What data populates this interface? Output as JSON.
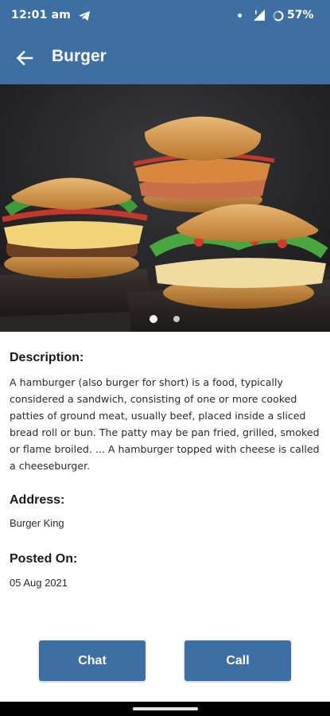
{
  "status_bar": {
    "time": "12:01 am",
    "battery_percent": "57%",
    "icons": [
      "telegram-icon",
      "notification-dot-icon",
      "signal-icon",
      "battery-ring-icon"
    ]
  },
  "app_bar": {
    "title": "Burger",
    "back_icon": "arrow-left-icon"
  },
  "carousel": {
    "image_description": "burger photo",
    "page_count": 2,
    "active_page": 1
  },
  "details": {
    "description_label": "Description:",
    "description_text": "A hamburger (also burger for short) is a food, typically considered a sandwich, consisting of one or more cooked patties of ground meat, usually beef, placed inside a sliced bread roll or bun. The patty may be pan fried, grilled, smoked or flame broiled. ... A hamburger topped with cheese is called a cheeseburger.",
    "address_label": "Address:",
    "address_value": "Burger King",
    "posted_label": "Posted On:",
    "posted_value": "05 Aug 2021"
  },
  "actions": {
    "chat_label": "Chat",
    "call_label": "Call"
  },
  "colors": {
    "primary": "#3e6fa3",
    "background": "#ffffff",
    "text": "#1b1b1b"
  }
}
